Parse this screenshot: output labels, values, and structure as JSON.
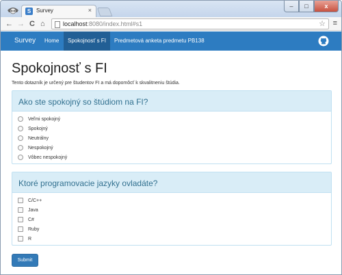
{
  "browser": {
    "tab_title": "Survey",
    "tab_favicon_letter": "S",
    "tab_close": "×",
    "url_host": "localhost",
    "url_rest": ":8080/index.html#s1",
    "back": "←",
    "forward": "→",
    "reload": "C",
    "home": "⌂",
    "star": "☆",
    "menu": "≡",
    "min": "–",
    "max": "□",
    "close": "x"
  },
  "navbar": {
    "brand": "Survey",
    "items": [
      {
        "label": "Home",
        "active": false
      },
      {
        "label": "Spokojnosť s FI",
        "active": true
      },
      {
        "label": "Predmetová anketa predmetu PB138",
        "active": false
      }
    ],
    "github_icon": "github-icon"
  },
  "page": {
    "title": "Spokojnosť s FI",
    "intro": "Tento dotazník je určený pre študentov FI a má dopomôcť k skvalitneniu štúdia."
  },
  "questions": [
    {
      "title": "Ako ste spokojný so štúdiom na FI?",
      "type": "radio",
      "options": [
        "Veľmi spokojný",
        "Spokojný",
        "Neutrálny",
        "Nespokojný",
        "Vôbec nespokojný"
      ]
    },
    {
      "title": "Ktoré programovacie jazyky ovladáte?",
      "type": "checkbox",
      "options": [
        "C/C++",
        "Java",
        "C#",
        "Ruby",
        "R"
      ]
    }
  ],
  "submit_label": "Submit",
  "colors": {
    "navbar": "#2d7cc1",
    "navbar_active": "#225f95",
    "panel_heading_bg": "#d9edf7",
    "panel_title": "#31708f",
    "button": "#337ab7"
  }
}
